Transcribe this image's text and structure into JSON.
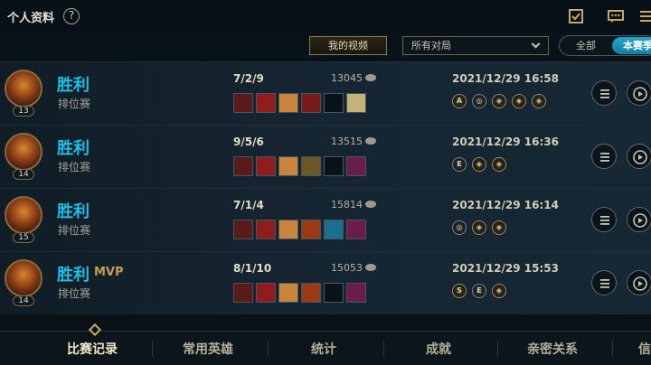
{
  "header": {
    "title": "个人资料",
    "help_symbol": "?",
    "icons": [
      "checklist-icon",
      "chat-icon",
      "menu-icon"
    ]
  },
  "filters": {
    "my_video": "我的视频",
    "mode": "所有对局",
    "season_all": "全部",
    "season_current": "本赛季"
  },
  "matches": [
    {
      "level": "13",
      "result": "胜利",
      "mvp": "",
      "queue": "排位赛",
      "kda": "7/2/9",
      "gold": "13045",
      "datetime": "2021/12/29 16:58",
      "runes": [
        "A",
        "◎",
        "◈",
        "◈",
        "◈"
      ]
    },
    {
      "level": "14",
      "result": "胜利",
      "mvp": "",
      "queue": "排位赛",
      "kda": "9/5/6",
      "gold": "13515",
      "datetime": "2021/12/29 16:36",
      "runes": [
        "E",
        "◈",
        "◈"
      ]
    },
    {
      "level": "15",
      "result": "胜利",
      "mvp": "",
      "queue": "排位赛",
      "kda": "7/1/4",
      "gold": "15814",
      "datetime": "2021/12/29 16:14",
      "runes": [
        "◎",
        "◈",
        "◈"
      ]
    },
    {
      "level": "14",
      "result": "胜利",
      "mvp": "MVP",
      "queue": "排位赛",
      "kda": "8/1/10",
      "gold": "15053",
      "datetime": "2021/12/29 15:53",
      "runes": [
        "S",
        "E",
        "◈"
      ]
    }
  ],
  "bottom_nav": {
    "tabs": [
      "比赛记录",
      "常用英雄",
      "统计",
      "成就",
      "亲密关系",
      "信"
    ],
    "active_index": 0
  },
  "colors": {
    "win_blue": "#1ec0e8",
    "gold_accent": "#c59e55",
    "active_tab": "#f1e6c5"
  }
}
